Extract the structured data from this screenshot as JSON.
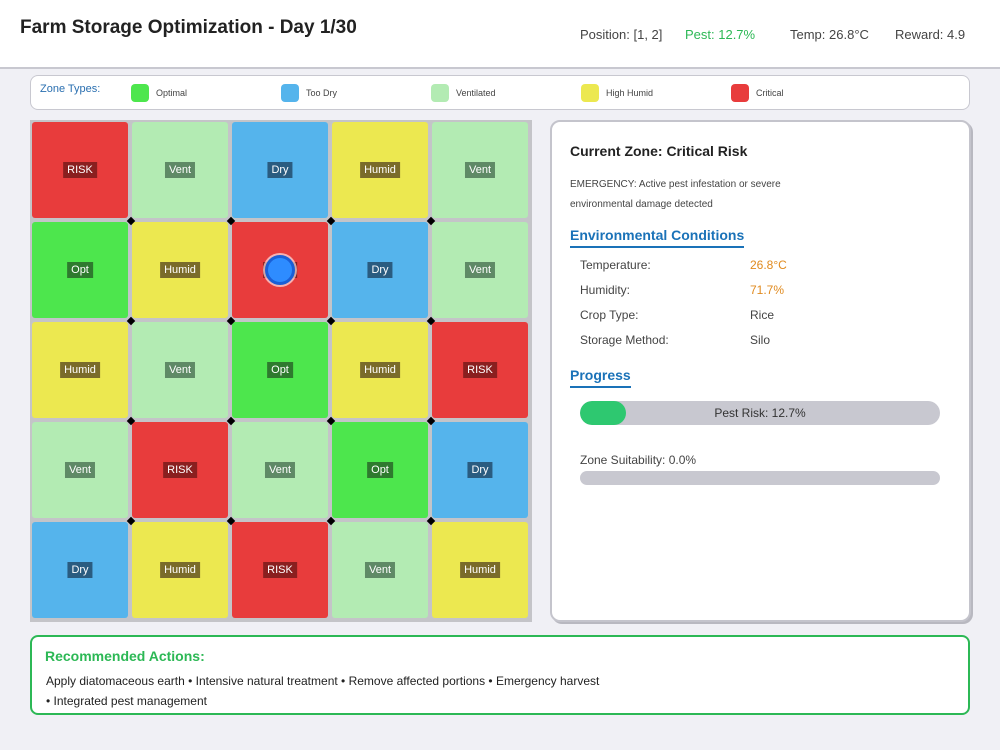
{
  "header": {
    "title": "Farm Storage Optimization - Day 1/30",
    "position": "Position: [1, 2]",
    "pest": "Pest: 12.7%",
    "temp": "Temp: 26.8°C",
    "reward": "Reward: 4.9"
  },
  "legend": {
    "title": "Zone Types:",
    "items": [
      {
        "label": "Optimal",
        "color": "#4de64d"
      },
      {
        "label": "Too Dry",
        "color": "#55b4ec"
      },
      {
        "label": "Ventilated",
        "color": "#b3ebb3"
      },
      {
        "label": "High Humid",
        "color": "#ece850"
      },
      {
        "label": "Critical",
        "color": "#e83c3c"
      }
    ]
  },
  "grid": {
    "agent": [
      1,
      2
    ],
    "rows": [
      [
        "RISK",
        "Vent",
        "Dry",
        "Humid",
        "Vent"
      ],
      [
        "Opt",
        "Humid",
        "RISK",
        "Dry",
        "Vent"
      ],
      [
        "Humid",
        "Vent",
        "Opt",
        "Humid",
        "RISK"
      ],
      [
        "Vent",
        "RISK",
        "Vent",
        "Opt",
        "Dry"
      ],
      [
        "Dry",
        "Humid",
        "RISK",
        "Vent",
        "Humid"
      ]
    ],
    "colors": {
      "RISK": "#e83c3c",
      "Vent": "#b3ebb3",
      "Dry": "#55b4ec",
      "Humid": "#ece850",
      "Opt": "#4de64d"
    }
  },
  "panel": {
    "zone_title": "Current Zone: Critical Risk",
    "zone_desc": "EMERGENCY: Active pest infestation or severe environmental damage detected",
    "env_title": "Environmental Conditions",
    "conditions": [
      {
        "label": "Temperature:",
        "value": "26.8°C",
        "color": "#e08a1e"
      },
      {
        "label": "Humidity:",
        "value": "71.7%",
        "color": "#e08a1e"
      },
      {
        "label": "Crop Type:",
        "value": "Rice",
        "color": "#444444"
      },
      {
        "label": "Storage Method:",
        "value": "Silo",
        "color": "#444444"
      }
    ],
    "progress_title": "Progress",
    "pest_risk_label": "Pest Risk: 12.7%",
    "pest_risk_fraction": 0.127,
    "suitability_label": "Zone Suitability: 0.0%",
    "suitability_fraction": 0.0
  },
  "actions": {
    "title": "Recommended Actions:",
    "text": "Apply diatomaceous earth • Intensive natural treatment • Remove affected portions • Emergency harvest • Integrated pest management"
  }
}
